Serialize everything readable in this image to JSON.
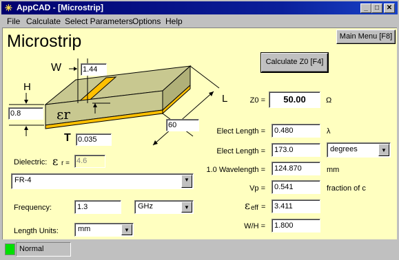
{
  "window": {
    "title": "AppCAD - [Microstrip]",
    "min_glyph": "_",
    "max_glyph": "□",
    "close_glyph": "✕"
  },
  "menu": [
    "File",
    "Calculate",
    "Select Parameters",
    "Options",
    "Help"
  ],
  "heading": "Microstrip",
  "main_menu_button": "Main Menu [F8]",
  "calc_button": "Calculate Z0  [F4]",
  "diagram": {
    "w_label": "W",
    "w_value": "1.44",
    "h_label": "H",
    "h_value": "0.8",
    "t_label": "T",
    "t_value": "0.035",
    "l_label": "L",
    "l_value": "60",
    "er_symbol": "εr"
  },
  "dielectric": {
    "label": "Dielectric:",
    "er_sym": "ε",
    "er_sub": "r =",
    "er_value": "4.6",
    "material": "FR-4"
  },
  "frequency": {
    "label": "Frequency:",
    "value": "1.3",
    "unit": "GHz"
  },
  "length_units": {
    "label": "Length Units:",
    "value": "mm"
  },
  "results": {
    "z0": {
      "label": "Z0 =",
      "value": "50.00",
      "unit": "Ω"
    },
    "elect_len_lambda": {
      "label": "Elect Length =",
      "value": "0.480",
      "unit": "λ"
    },
    "elect_len_deg": {
      "label": "Elect Length =",
      "value": "173.0",
      "unit": "degrees"
    },
    "wavelength": {
      "label": "1.0 Wavelength =",
      "value": "124.870",
      "unit": "mm"
    },
    "vp": {
      "label": "Vp =",
      "value": "0.541",
      "unit": "fraction of c"
    },
    "eeff": {
      "sym": "ε",
      "sub": "eff",
      "label": "=",
      "value": "3.411"
    },
    "wh": {
      "label": "W/H =",
      "value": "1.800"
    }
  },
  "status": {
    "text": "Normal",
    "led_color": "#00e000"
  }
}
